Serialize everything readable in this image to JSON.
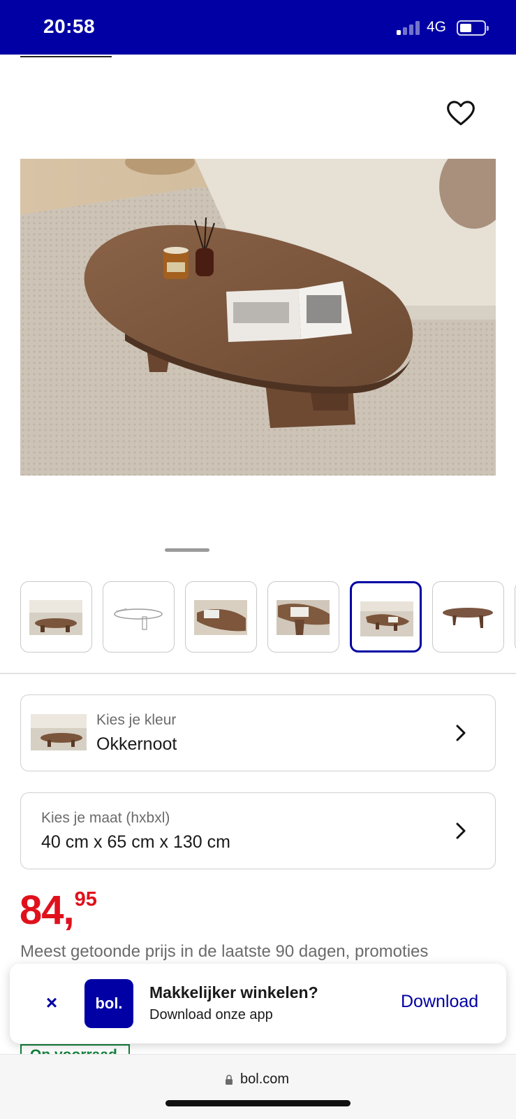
{
  "status_bar": {
    "time": "20:58",
    "network": "4G"
  },
  "product": {
    "favorite_icon": "heart-outline-icon",
    "image_alt": "Walnut oval coffee table with candle, diffuser and magazine on a rug",
    "thumbnail_count": 6,
    "active_thumbnail_index": 4
  },
  "selectors": {
    "color_label": "Kies je kleur",
    "color_value": "Okkernoot",
    "size_label": "Kies je maat (hxbxl)",
    "size_value": "40 cm x 65 cm x 130 cm"
  },
  "price": {
    "integer": "84,",
    "decimal": "95",
    "note": "Meest getoonde prijs in de laatste 90 dagen, promoties"
  },
  "stock": {
    "label": "Op voorraad"
  },
  "app_banner": {
    "close_glyph": "×",
    "logo_text": "bol.",
    "title": "Makkelijker winkelen?",
    "subtitle": "Download onze app",
    "download_label": "Download"
  },
  "browser": {
    "url": "bol.com"
  },
  "colors": {
    "brand_blue": "#0000a4",
    "price_red": "#e0111c",
    "stock_green": "#11803a"
  }
}
